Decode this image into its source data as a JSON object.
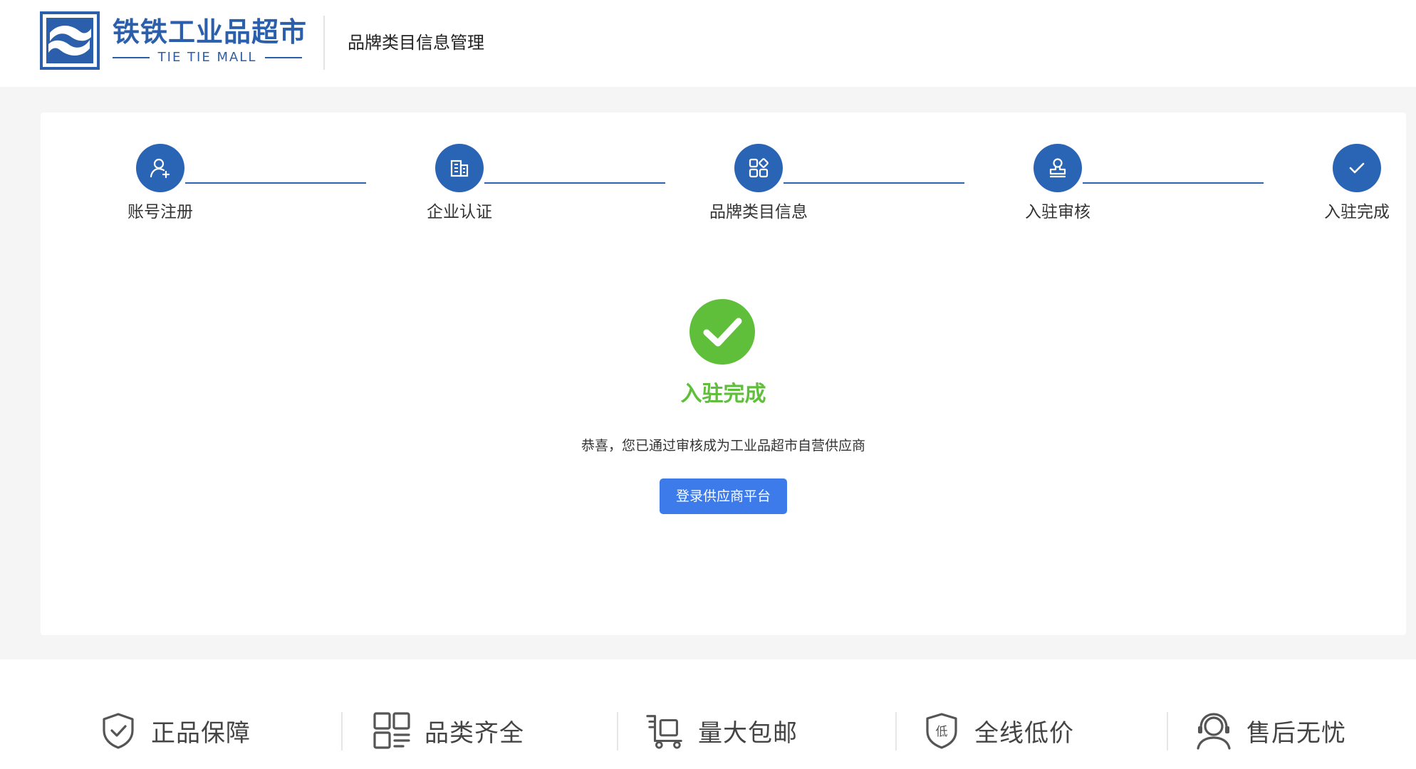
{
  "brand": {
    "name_cn": "铁铁工业品超市",
    "name_en": "TIE TIE MALL",
    "color": "#2c5fab"
  },
  "header": {
    "title": "品牌类目信息管理"
  },
  "steps": [
    {
      "label": "账号注册",
      "icon": "user-add-icon"
    },
    {
      "label": "企业认证",
      "icon": "building-icon"
    },
    {
      "label": "品牌类目信息",
      "icon": "grid-apps-icon"
    },
    {
      "label": "入驻审核",
      "icon": "stamp-icon"
    },
    {
      "label": "入驻完成",
      "icon": "check-icon"
    }
  ],
  "step_color": "#2a64b4",
  "result": {
    "icon": "success-check-icon",
    "title": "入驻完成",
    "description": "恭喜，您已通过审核成为工业品超市自营供应商",
    "button_label": "登录供应商平台",
    "title_color": "#5fbf3b",
    "button_color": "#3d7bea"
  },
  "features": [
    {
      "label": "正品保障",
      "icon": "shield-check-icon"
    },
    {
      "label": "品类齐全",
      "icon": "categories-icon"
    },
    {
      "label": "量大包邮",
      "icon": "delivery-cart-icon"
    },
    {
      "label": "全线低价",
      "icon": "low-price-shield-icon"
    },
    {
      "label": "售后无忧",
      "icon": "customer-service-icon"
    }
  ]
}
